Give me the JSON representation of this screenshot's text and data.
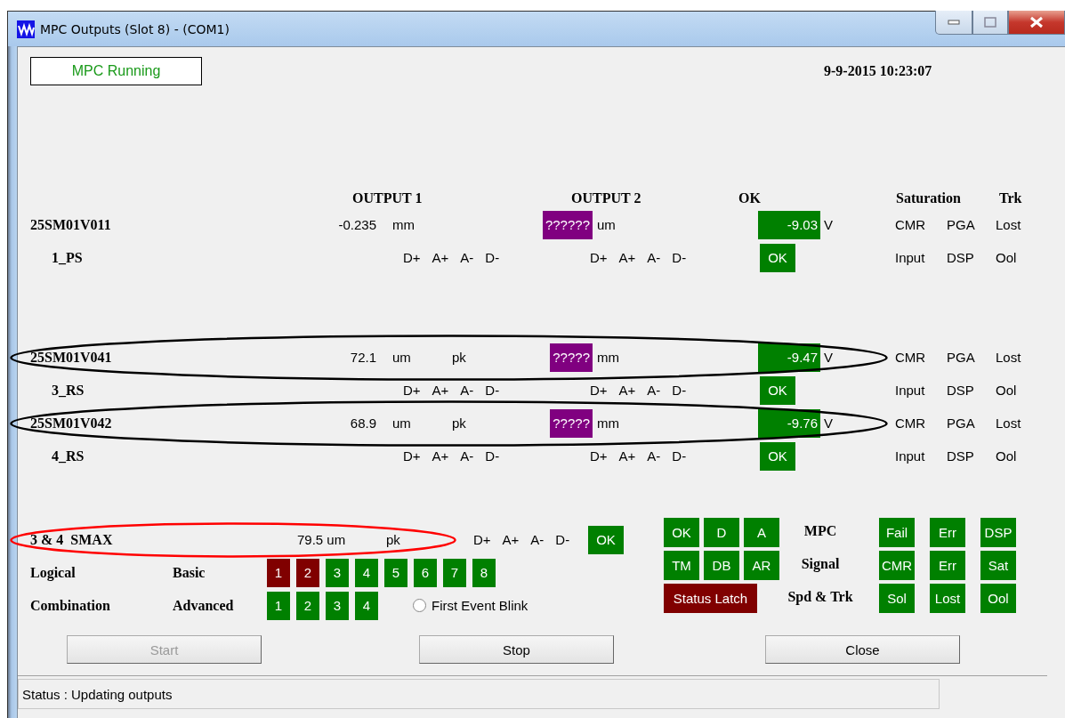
{
  "window": {
    "title": "MPC Outputs (Slot 8) - (COM1)"
  },
  "run_state": {
    "label": "MPC Running"
  },
  "timestamp": "9-9-2015  10:23:07",
  "headers": [
    "OUTPUT 1",
    "OUTPUT 2",
    "OK",
    "Saturation",
    "Trk"
  ],
  "channels": [
    {
      "name": "25SM01V011",
      "sensor": "1_PS",
      "value": "-0.235",
      "unit": "mm",
      "output_2": {
        "value": "??????",
        "unit": "um",
        "color": "#800080"
      },
      "voltage": {
        "value": "-9.03",
        "unit": "V",
        "color": "#008000"
      },
      "saturation": [
        "CMR",
        "PGA",
        "Lost"
      ],
      "flags_1": [
        "D+",
        "A+",
        "A-",
        "D-"
      ],
      "flags_2": [
        "D+",
        "A+",
        "A-",
        "D-"
      ],
      "ok": {
        "label": "OK",
        "color": "#008000"
      },
      "status": [
        "Input",
        "DSP",
        "Ool"
      ]
    },
    {
      "name": "25SM01V041",
      "sensor": "3_RS",
      "value": "72.1",
      "unit": "um",
      "peak": "pk",
      "output_2": {
        "value": "?????",
        "unit": "mm",
        "color": "#800080"
      },
      "voltage": {
        "value": "-9.47",
        "unit": "V",
        "color": "#008000"
      },
      "saturation": [
        "CMR",
        "PGA",
        "Lost"
      ],
      "flags_1": [
        "D+",
        "A+",
        "A-",
        "D-"
      ],
      "flags_2": [
        "D+",
        "A+",
        "A-",
        "D-"
      ],
      "ok": {
        "label": "OK",
        "color": "#008000"
      },
      "status": [
        "Input",
        "DSP",
        "Ool"
      ],
      "circled": true
    },
    {
      "name": "25SM01V042",
      "sensor": "4_RS",
      "value": "68.9",
      "unit": "um",
      "peak": "pk",
      "output_2": {
        "value": "?????",
        "unit": "mm",
        "color": "#800080"
      },
      "voltage": {
        "value": "-9.76",
        "unit": "V",
        "color": "#008000"
      },
      "saturation": [
        "CMR",
        "PGA",
        "Lost"
      ],
      "flags_1": [
        "D+",
        "A+",
        "A-",
        "D-"
      ],
      "flags_2": [
        "D+",
        "A+",
        "A-",
        "D-"
      ],
      "ok": {
        "label": "OK",
        "color": "#008000"
      },
      "status": [
        "Input",
        "DSP",
        "Ool"
      ],
      "circled": true
    }
  ],
  "smax": {
    "name": "3 & 4  SMAX",
    "value": "79.5 um",
    "peak": "pk",
    "flags": [
      "D+",
      "A+",
      "A-",
      "D-"
    ],
    "ok": {
      "label": "OK",
      "color": "#008000"
    },
    "circled": true
  },
  "logic_rows": [
    {
      "label": "Logical",
      "type": "Basic",
      "boxes": [
        {
          "label": "1",
          "color": "#800000"
        },
        {
          "label": "2",
          "color": "#800000"
        },
        {
          "label": "3",
          "color": "#008000"
        },
        {
          "label": "4",
          "color": "#008000"
        },
        {
          "label": "5",
          "color": "#008000"
        },
        {
          "label": "6",
          "color": "#008000"
        },
        {
          "label": "7",
          "color": "#008000"
        },
        {
          "label": "8",
          "color": "#008000"
        }
      ]
    },
    {
      "label": "Combination",
      "type": "Advanced",
      "boxes": [
        {
          "label": "1",
          "color": "#008000"
        },
        {
          "label": "2",
          "color": "#008000"
        },
        {
          "label": "3",
          "color": "#008000"
        },
        {
          "label": "4",
          "color": "#008000"
        }
      ]
    }
  ],
  "first_event_blink": {
    "label": "First Event Blink",
    "checked": false
  },
  "indicator_rows": [
    {
      "left": [
        {
          "label": "OK",
          "color": "#008000"
        },
        {
          "label": "D",
          "color": "#008000"
        },
        {
          "label": "A",
          "color": "#008000"
        }
      ],
      "label": "MPC",
      "right": [
        {
          "label": "Fail",
          "color": "#008000"
        },
        {
          "label": "Err",
          "color": "#008000"
        },
        {
          "label": "DSP",
          "color": "#008000"
        }
      ]
    },
    {
      "left": [
        {
          "label": "TM",
          "color": "#008000"
        },
        {
          "label": "DB",
          "color": "#008000"
        },
        {
          "label": "AR",
          "color": "#008000"
        }
      ],
      "label": "Signal",
      "right": [
        {
          "label": "CMR",
          "color": "#008000"
        },
        {
          "label": "Err",
          "color": "#008000"
        },
        {
          "label": "Sat",
          "color": "#008000"
        }
      ]
    },
    {
      "left": [
        {
          "label": "Status Latch",
          "color": "#800000"
        }
      ],
      "label": "Spd & Trk",
      "right": [
        {
          "label": "Sol",
          "color": "#008000"
        },
        {
          "label": "Lost",
          "color": "#008000"
        },
        {
          "label": "Ool",
          "color": "#008000"
        }
      ]
    }
  ],
  "buttons": [
    {
      "label": "Start",
      "disabled": true
    },
    {
      "label": "Stop",
      "disabled": false
    },
    {
      "label": "Close",
      "disabled": false
    }
  ],
  "status_bar": "Status : Updating outputs"
}
